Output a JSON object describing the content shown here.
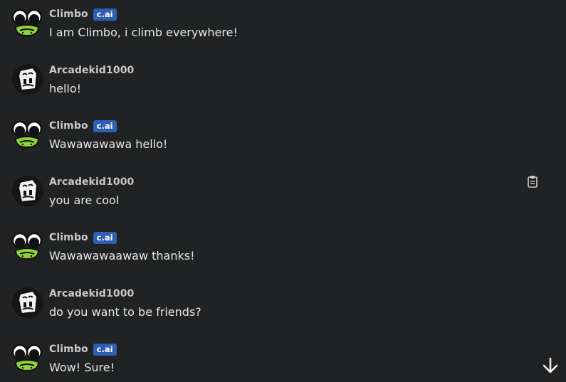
{
  "messages": [
    {
      "author": "Climbo",
      "badge": "c.ai",
      "text": "I am Climbo, i climb everywhere!",
      "avatar": "frog-avatar"
    },
    {
      "author": "Arcadekid1000",
      "badge": "",
      "text": "hello!",
      "avatar": "cube-avatar"
    },
    {
      "author": "Climbo",
      "badge": "c.ai",
      "text": "Wawawawawa hello!",
      "avatar": "frog-avatar"
    },
    {
      "author": "Arcadekid1000",
      "badge": "",
      "text": "you are cool",
      "avatar": "cube-avatar",
      "action_icon": "clipboard-icon"
    },
    {
      "author": "Climbo",
      "badge": "c.ai",
      "text": "Wawawawaawaw thanks!",
      "avatar": "frog-avatar"
    },
    {
      "author": "Arcadekid1000",
      "badge": "",
      "text": "do you want to be friends?",
      "avatar": "cube-avatar"
    },
    {
      "author": "Climbo",
      "badge": "c.ai",
      "text": "Wow! Sure!",
      "avatar": "frog-avatar"
    }
  ],
  "scroll_button_icon": "arrow-down-icon",
  "colors": {
    "background": "#212223",
    "badge": "#2f5fb5",
    "frog_green": "#8dd33a"
  }
}
